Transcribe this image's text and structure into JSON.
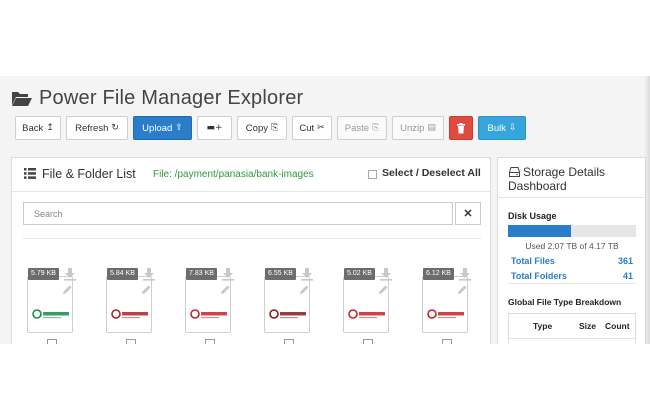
{
  "app": {
    "title": "Power File Manager Explorer"
  },
  "toolbar": {
    "back": {
      "label": "Back",
      "icon": "↥"
    },
    "refresh": {
      "label": "Refresh",
      "icon": "↻"
    },
    "upload": {
      "label": "Upload",
      "icon": "⇪"
    },
    "newfolder": {
      "icon": "▬+"
    },
    "copy": {
      "label": "Copy",
      "icon": "⎘"
    },
    "cut": {
      "label": "Cut",
      "icon": "✂"
    },
    "paste": {
      "label": "Paste",
      "icon": "⎘"
    },
    "unzip": {
      "label": "Unzip",
      "icon": "▤"
    },
    "delete": {
      "icon": "🗑"
    },
    "bulk": {
      "label": "Bulk",
      "icon": "⇩"
    }
  },
  "colors": {
    "primary": "#2a7dc9",
    "danger": "#e04a3f",
    "info": "#36a5dc",
    "path_green": "#2e9a3c",
    "badge_gray": "#6c6c6c"
  },
  "file_list": {
    "title": "File & Folder List",
    "path": "File: /payment/panasia/bank-images",
    "select_all_label": "Select / Deselect All",
    "search": {
      "placeholder": "Search",
      "value": "",
      "clear_icon": "✕"
    },
    "files": [
      {
        "size": "5.79 KB",
        "logo": "中国农业银行",
        "color": "#1a8a4a"
      },
      {
        "size": "5.84 KB",
        "logo": "南京银行",
        "color": "#b0202a"
      },
      {
        "size": "7.83 KB",
        "logo": "北京农商银行",
        "color": "#c8202a"
      },
      {
        "size": "6.55 KB",
        "logo": "富滇银行",
        "color": "#8a1a1a"
      },
      {
        "size": "5.02 KB",
        "logo": "广州银行",
        "color": "#c8202a"
      },
      {
        "size": "6.12 KB",
        "logo": "贵阳银行",
        "color": "#c8202a"
      }
    ]
  },
  "storage": {
    "title": "Storage Details Dashboard",
    "disk_usage_label": "Disk Usage",
    "used_fraction": 0.496,
    "used_text": "Used 2.07 TB of 4.17 TB",
    "total_files_label": "Total Files",
    "total_files": "361",
    "total_folders_label": "Total Folders",
    "total_folders": "41",
    "breakdown_label": "Global File Type Breakdown",
    "columns": [
      "Type",
      "Size",
      "Count"
    ]
  }
}
